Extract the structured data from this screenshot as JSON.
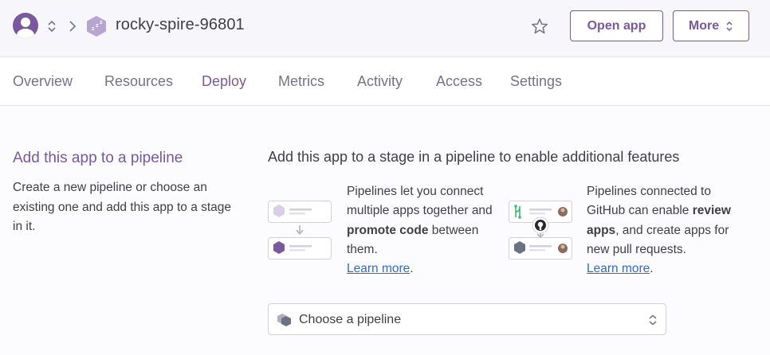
{
  "header": {
    "app_name": "rocky-spire-96801",
    "open_app_label": "Open app",
    "more_label": "More"
  },
  "tabs": [
    {
      "label": "Overview"
    },
    {
      "label": "Resources"
    },
    {
      "label": "Deploy"
    },
    {
      "label": "Metrics"
    },
    {
      "label": "Activity"
    },
    {
      "label": "Access"
    },
    {
      "label": "Settings"
    }
  ],
  "active_tab": "Deploy",
  "pipeline": {
    "title": "Add this app to a pipeline",
    "description": "Create a new pipeline or choose an existing one and add this app to a stage in it.",
    "stage_title": "Add this app to a stage in a pipeline to enable additional features",
    "feature1": {
      "text_a": "Pipelines let you connect multiple apps together and ",
      "bold": "promote code",
      "text_b": " between them.",
      "link": "Learn more",
      "suffix": "."
    },
    "feature2": {
      "text_a": "Pipelines connected to GitHub can enable ",
      "bold": "review apps",
      "text_b": ", and create apps for new pull requests.",
      "link": "Learn more",
      "suffix": "."
    },
    "select_placeholder": "Choose a pipeline"
  },
  "colors": {
    "brand": "#79589f",
    "link": "#2a6fcc",
    "text": "#3f3f44",
    "muted": "#75728a"
  },
  "icons": [
    "user-avatar-icon",
    "chevron-updown-icon",
    "chevron-right-icon",
    "sleeping-app-icon",
    "star-icon",
    "pipeline-hexagon-icon",
    "github-icon"
  ]
}
